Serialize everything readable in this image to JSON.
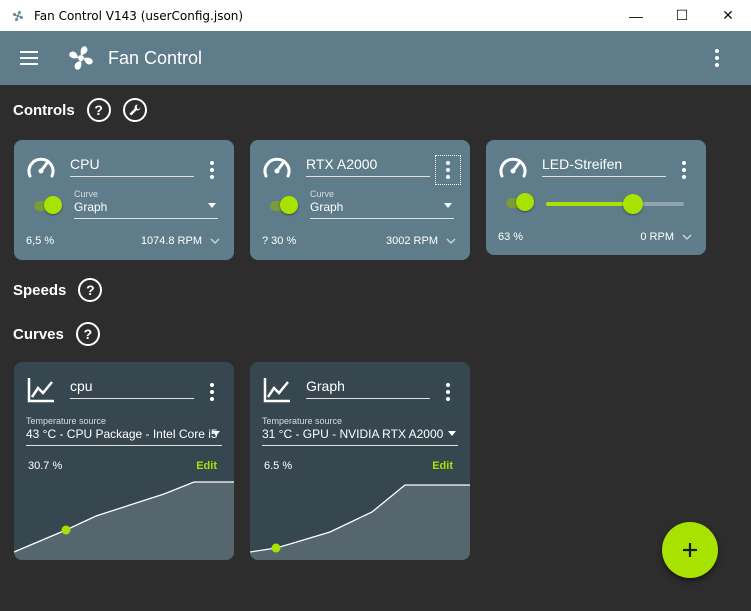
{
  "window": {
    "title": "Fan Control V143 (userConfig.json)",
    "minimize_glyph": "—",
    "maximize_glyph": "☐",
    "close_glyph": "✕"
  },
  "appbar": {
    "title": "Fan Control"
  },
  "sections": {
    "controls": "Controls",
    "speeds": "Speeds",
    "curves": "Curves"
  },
  "controls": [
    {
      "name": "CPU",
      "curve_label": "Curve",
      "curve_value": "Graph",
      "percent": "6,5 %",
      "rpm": "1074.8 RPM",
      "enabled": true
    },
    {
      "name": "RTX A2000",
      "curve_label": "Curve",
      "curve_value": "Graph",
      "percent": "? 30 %",
      "rpm": "3002 RPM",
      "enabled": true
    },
    {
      "name": "LED-Streifen",
      "percent": "63 %",
      "rpm": "0 RPM",
      "enabled": true,
      "slider_value": 0.63
    }
  ],
  "curves": [
    {
      "name": "cpu",
      "temp_label": "Temperature source",
      "temp_value": "43 °C - CPU Package - Intel Core i5",
      "percent": "30.7 %",
      "edit_label": "Edit"
    },
    {
      "name": "Graph",
      "temp_label": "Temperature source",
      "temp_value": "31 °C - GPU - NVIDIA RTX A2000",
      "percent": "6.5 %",
      "edit_label": "Edit"
    }
  ],
  "help_glyph": "?",
  "colors": {
    "accent": "#a8e200",
    "appbar": "#5f7c8a",
    "background": "#2d2d2d",
    "curve_card": "#37474f"
  },
  "icons": {
    "menu": "menu-icon",
    "logo": "fan-icon",
    "more": "more-vert-icon",
    "gauge": "speedometer-icon",
    "curve": "chart-line-icon",
    "help": "help-circle-icon",
    "wrench": "wrench-icon",
    "add": "plus-icon"
  }
}
